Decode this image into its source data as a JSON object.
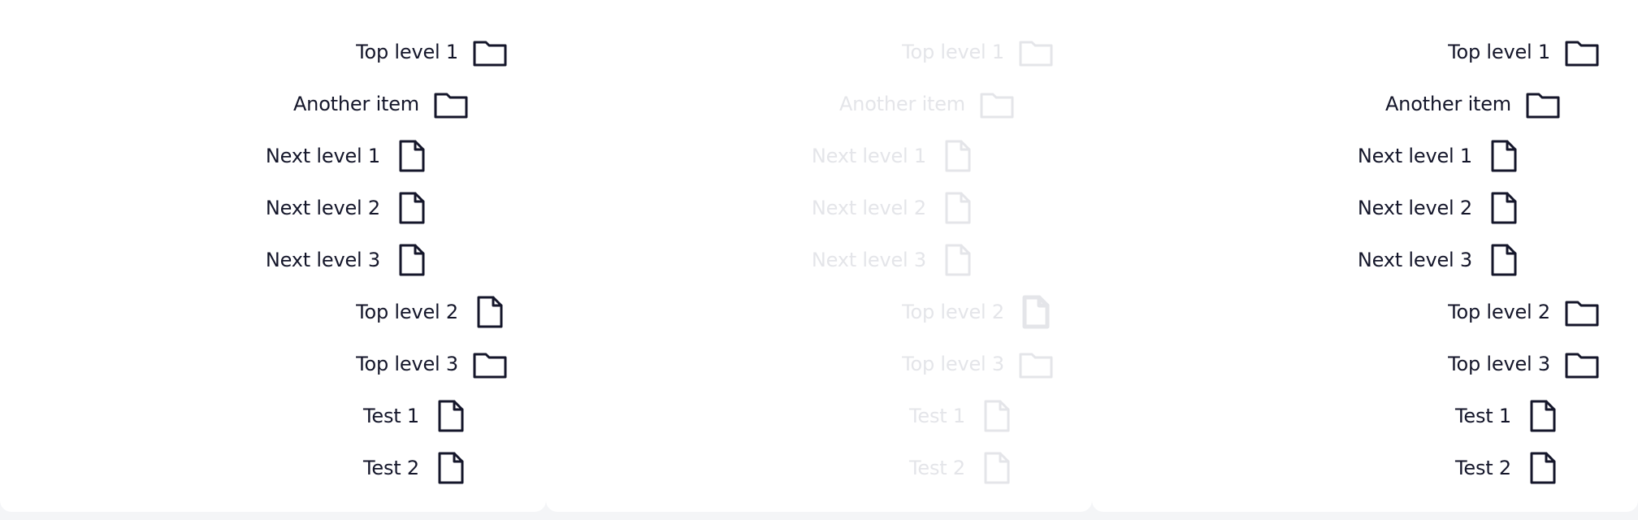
{
  "panels": [
    {
      "state": "normal",
      "items": [
        {
          "label": "Top level 1",
          "icon": "folder-icon"
        },
        {
          "label": "Another item",
          "icon": "folder-icon"
        },
        {
          "label": "Next level 1",
          "icon": "file-icon"
        },
        {
          "label": "Next level 2",
          "icon": "file-icon"
        },
        {
          "label": "Next level 3",
          "icon": "file-icon"
        },
        {
          "label": "Top level 2",
          "icon": "file-icon"
        },
        {
          "label": "Top level 3",
          "icon": "folder-icon"
        },
        {
          "label": "Test 1",
          "icon": "file-icon"
        },
        {
          "label": "Test 2",
          "icon": "file-icon"
        }
      ]
    },
    {
      "state": "dragging",
      "items": [
        {
          "label": "Top level 1",
          "icon": "folder-icon"
        },
        {
          "label": "Another item",
          "icon": "folder-icon"
        },
        {
          "label": "Next level 1",
          "icon": "file-icon"
        },
        {
          "label": "Next level 2",
          "icon": "file-icon"
        },
        {
          "label": "Next level 3",
          "icon": "file-icon"
        },
        {
          "label": "Top level 2",
          "icon": "file-icon",
          "highlighted": true
        },
        {
          "label": "Top level 3",
          "icon": "folder-icon"
        },
        {
          "label": "Test 1",
          "icon": "file-icon"
        },
        {
          "label": "Test 2",
          "icon": "file-icon"
        }
      ]
    },
    {
      "state": "dropped",
      "items": [
        {
          "label": "Top level 1",
          "icon": "folder-icon"
        },
        {
          "label": "Another item",
          "icon": "folder-icon"
        },
        {
          "label": "Next level 1",
          "icon": "file-icon"
        },
        {
          "label": "Next level 2",
          "icon": "file-icon"
        },
        {
          "label": "Next level 3",
          "icon": "file-icon"
        },
        {
          "label": "Top level 2",
          "icon": "folder-icon"
        },
        {
          "label": "Top level 3",
          "icon": "folder-icon"
        },
        {
          "label": "Test 1",
          "icon": "file-icon"
        },
        {
          "label": "Test 2",
          "icon": "file-icon"
        }
      ]
    }
  ],
  "colors": {
    "text": "#14162a",
    "faded": "#e4e5e9",
    "highlight": "#ff0000",
    "highlight_dash": "#ffd400",
    "panel_bg": "#ffffff",
    "page_bg": "#f4f5f7"
  }
}
